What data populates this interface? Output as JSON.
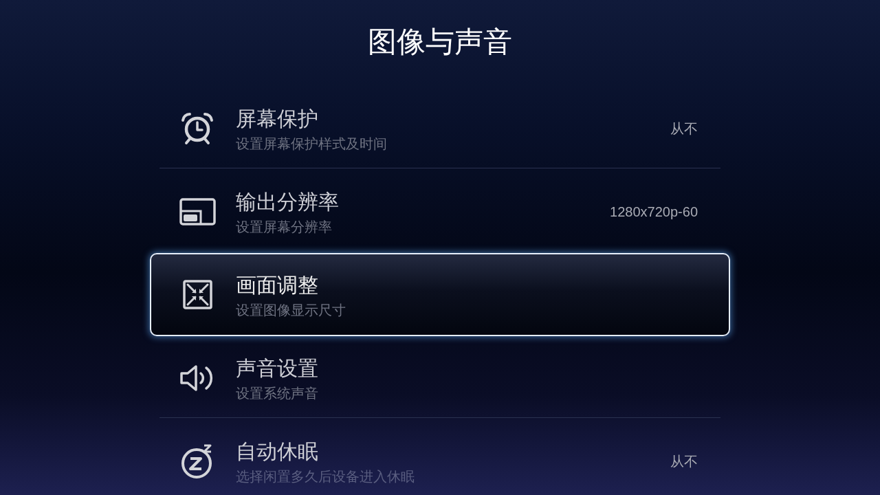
{
  "title": "图像与声音",
  "items": [
    {
      "title": "屏幕保护",
      "subtitle": "设置屏幕保护样式及时间",
      "value": "从不",
      "selected": false
    },
    {
      "title": "输出分辨率",
      "subtitle": "设置屏幕分辨率",
      "value": "1280x720p-60",
      "selected": false
    },
    {
      "title": "画面调整",
      "subtitle": "设置图像显示尺寸",
      "selected": true
    },
    {
      "title": "声音设置",
      "subtitle": "设置系统声音",
      "selected": false
    },
    {
      "title": "自动休眠",
      "subtitle": "选择闲置多久后设备进入休眠",
      "value": "从不",
      "selected": false
    }
  ]
}
